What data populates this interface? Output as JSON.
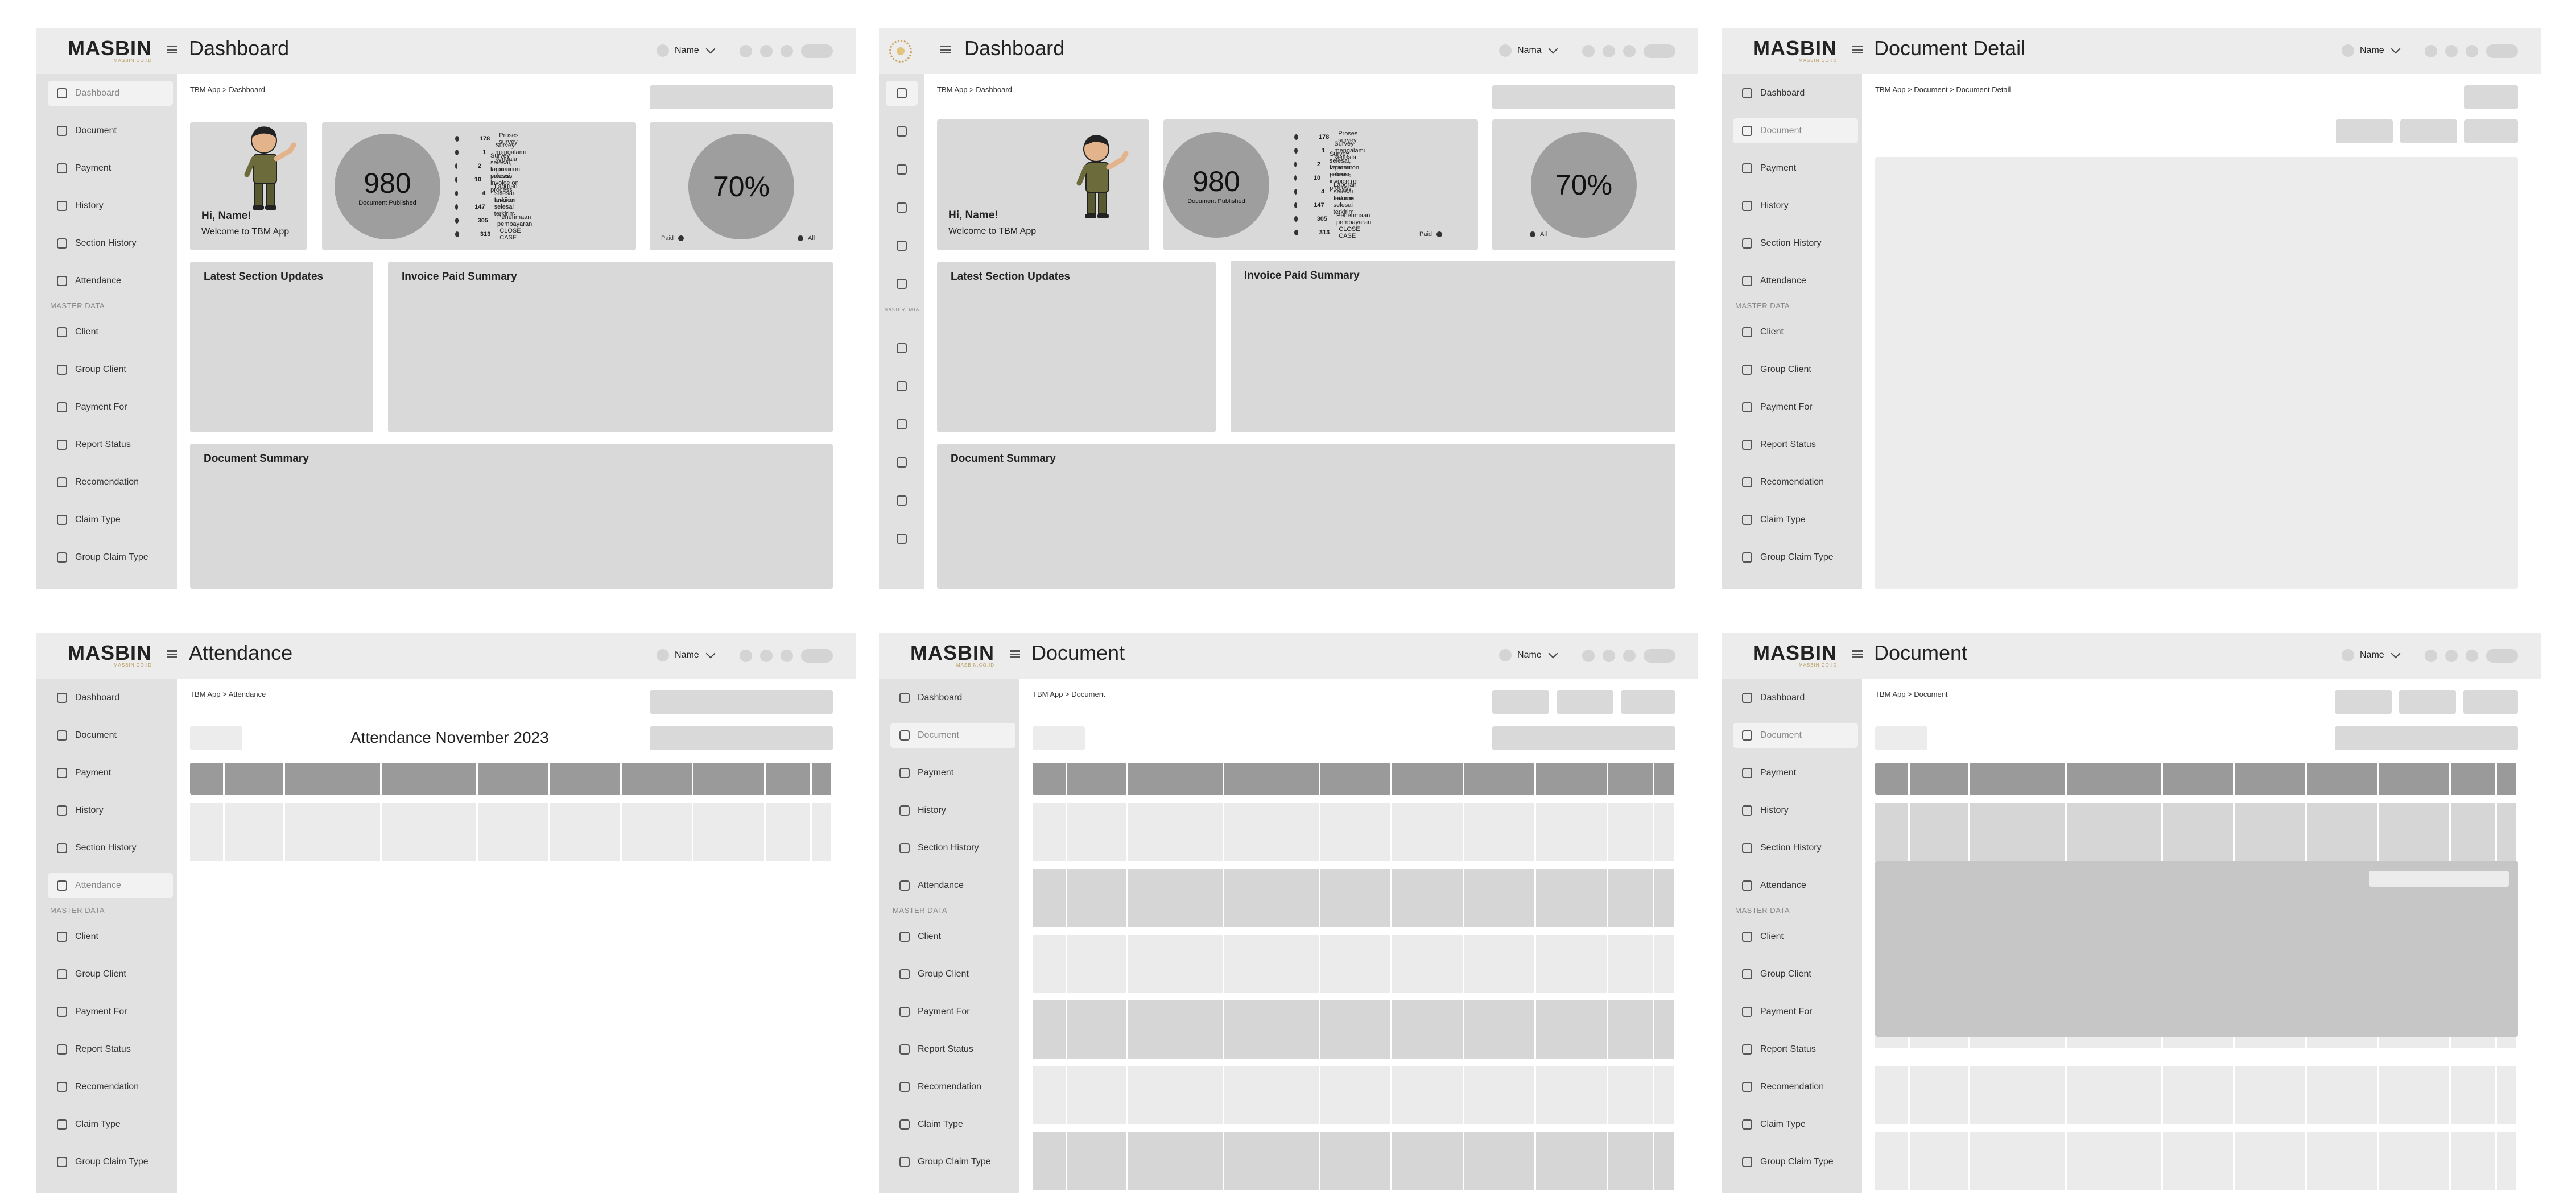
{
  "brand": {
    "logo": "MASBIN",
    "logo_sub": "MASBIN.CO.ID"
  },
  "common": {
    "user_name": "Name",
    "app_crumb": "TBM App",
    "section_label": "MASTER DATA"
  },
  "nav_items": [
    "Dashboard",
    "Document",
    "Payment",
    "History",
    "Section History",
    "Attendance"
  ],
  "master_items": [
    "Client",
    "Group Client",
    "Payment For",
    "Report Status",
    "Recomendation",
    "Claim Type",
    "Group Claim Type"
  ],
  "icons": {
    "Dashboard": "home-icon",
    "Document": "document-icon",
    "Payment": "wallet-icon",
    "History": "clock-icon",
    "Section History": "undo-icon",
    "Attendance": "calendar-icon",
    "Client": "user-icon",
    "Group Client": "users-icon",
    "Payment For": "receipt-icon",
    "Report Status": "message-icon",
    "Recomendation": "thumbs-up-icon",
    "Claim Type": "box-icon",
    "Group Claim Type": "group-icon"
  },
  "screens": [
    {
      "title": "Dashboard",
      "breadcrumb": "TBM App > Dashboard",
      "active": "Dashboard",
      "variant": "full"
    },
    {
      "title": "Dashboard",
      "breadcrumb": "TBM App > Dashboard",
      "active": "Dashboard",
      "variant": "mini",
      "user_name": "Nama"
    },
    {
      "title": "Document Detail",
      "breadcrumb": "TBM App > Document  > Document Detail",
      "active": "Document"
    },
    {
      "title": "Attendance",
      "breadcrumb": "TBM App > Attendance",
      "active": "Attendance"
    },
    {
      "title": "Document",
      "breadcrumb": "TBM App > Document",
      "active": "Document"
    },
    {
      "title": "Document",
      "breadcrumb": "TBM App > Document",
      "active": "Document"
    }
  ],
  "dashboard": {
    "greeting": "Hi, Name!",
    "welcome": "Welcome to TBM App",
    "published_count": "980",
    "published_label": "Document Published",
    "percent": "70%",
    "percent_value": 0.7,
    "legend_paid": "Paid",
    "legend_all": "All",
    "stats": [
      {
        "n": "178",
        "label": "Proses survey"
      },
      {
        "n": "1",
        "label": "Survey mengalami kendala"
      },
      {
        "n": "2",
        "label": "Survey selesai, laporan on process"
      },
      {
        "n": "10",
        "label": "Laporan selesai, invoice on process"
      },
      {
        "n": "4",
        "label": "Laporan selesai terkirim"
      },
      {
        "n": "147",
        "label": "Invoice selesai terkirim"
      },
      {
        "n": "305",
        "label": "Penerimaan pembayaran"
      },
      {
        "n": "313",
        "label": "CLOSE CASE"
      }
    ],
    "latest_updates": "Latest Section Updates",
    "invoice_summary": "Invoice Paid Summary",
    "document_summary": "Document Summary"
  },
  "attendance": {
    "heading": "Attendance November 2023"
  }
}
